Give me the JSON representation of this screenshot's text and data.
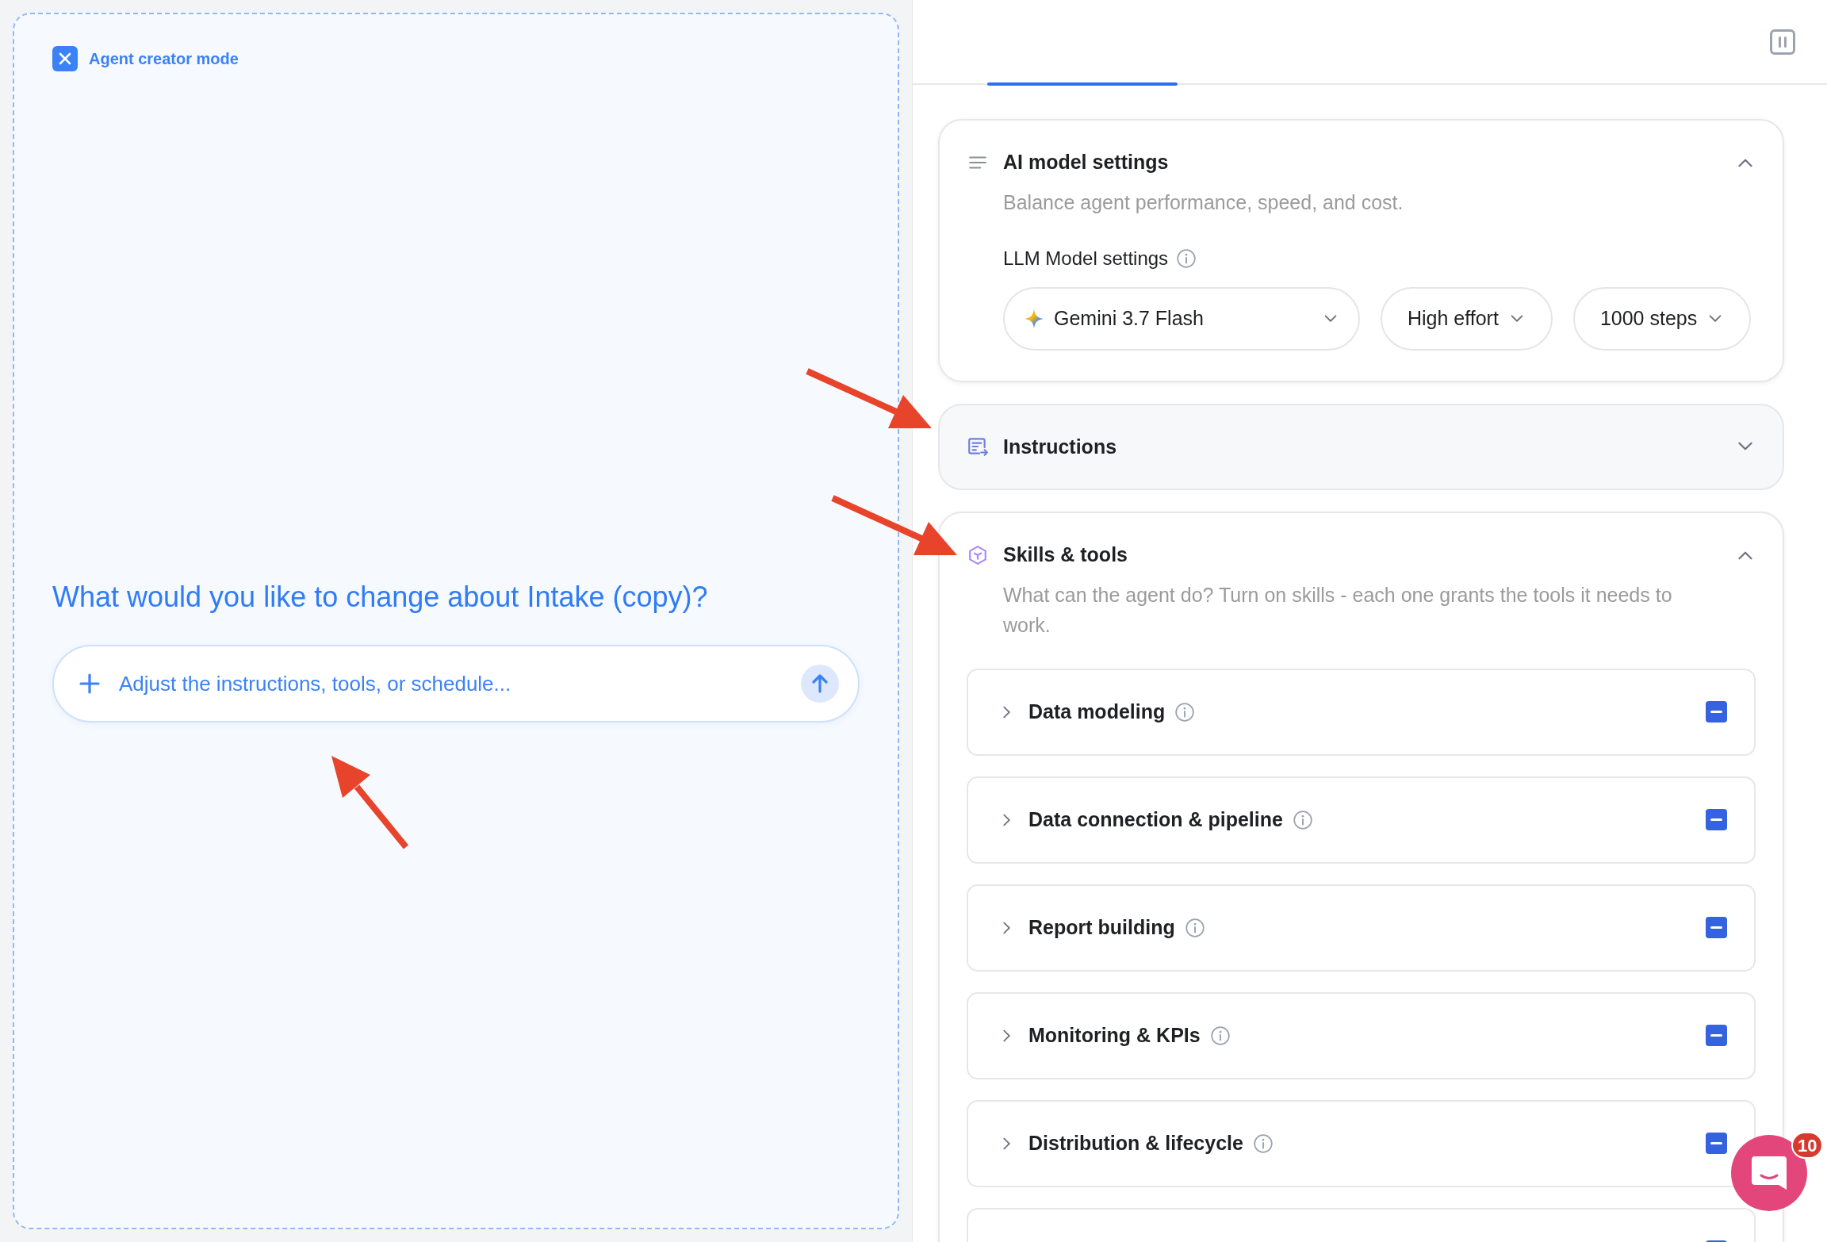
{
  "left_panel": {
    "mode_label": "Agent creator mode",
    "question": "What would you like to change about Intake (copy)?",
    "input": {
      "placeholder": "Adjust the instructions, tools, or schedule..."
    }
  },
  "sections": [
    {
      "kind": "model",
      "title": "AI model settings",
      "description": "Balance agent performance, speed, and cost.",
      "expanded": true,
      "llm_label": "LLM Model settings",
      "dropdowns": [
        {
          "kind": "model",
          "label": "Gemini 3.7 Flash"
        },
        {
          "kind": "option",
          "label": "High effort"
        },
        {
          "kind": "option",
          "label": "1000 steps"
        }
      ]
    },
    {
      "kind": "instructions",
      "title": "Instructions",
      "expanded": false
    },
    {
      "kind": "skills",
      "title": "Skills & tools",
      "description": "What can the agent do? Turn on skills - each one grants the tools it needs to work.",
      "expanded": true,
      "skills": [
        {
          "label": "Data modeling",
          "expanded": false,
          "checked": true
        },
        {
          "label": "Data connection & pipeline",
          "expanded": false,
          "checked": true
        },
        {
          "label": "Report building",
          "expanded": false,
          "checked": true
        },
        {
          "label": "Monitoring & KPIs",
          "expanded": false,
          "checked": true
        },
        {
          "label": "Distribution & lifecycle",
          "expanded": false,
          "checked": true
        },
        {
          "checked": true
        }
      ]
    }
  ],
  "chat_widget": {
    "badge": "10"
  }
}
